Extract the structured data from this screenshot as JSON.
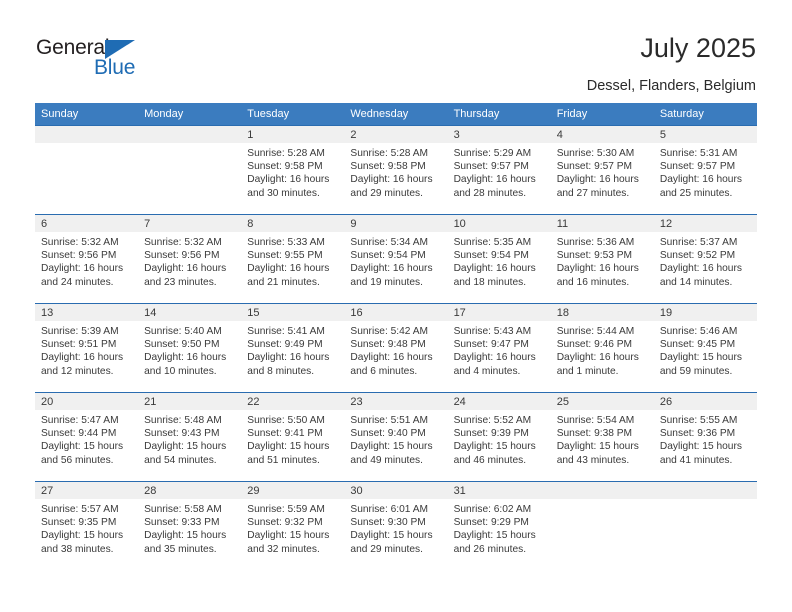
{
  "brand": {
    "name_part1": "General",
    "name_part2": "Blue"
  },
  "header": {
    "month_title": "July 2025",
    "location": "Dessel, Flanders, Belgium"
  },
  "colors": {
    "header_row_bg": "#3b7cbf",
    "week_border": "#2a6cb0",
    "daynum_band_bg": "#f0f0f0",
    "brand_blue": "#1f6cb4",
    "text": "#3a3a3a"
  },
  "weekdays": [
    "Sunday",
    "Monday",
    "Tuesday",
    "Wednesday",
    "Thursday",
    "Friday",
    "Saturday"
  ],
  "labels": {
    "sunrise_prefix": "Sunrise:",
    "sunset_prefix": "Sunset:",
    "daylight_prefix": "Daylight:"
  },
  "weeks": [
    [
      {
        "day": "",
        "empty": true
      },
      {
        "day": "",
        "empty": true
      },
      {
        "day": "1",
        "sunrise": "Sunrise: 5:28 AM",
        "sunset": "Sunset: 9:58 PM",
        "daylight_line1": "Daylight: 16 hours",
        "daylight_line2": "and 30 minutes."
      },
      {
        "day": "2",
        "sunrise": "Sunrise: 5:28 AM",
        "sunset": "Sunset: 9:58 PM",
        "daylight_line1": "Daylight: 16 hours",
        "daylight_line2": "and 29 minutes."
      },
      {
        "day": "3",
        "sunrise": "Sunrise: 5:29 AM",
        "sunset": "Sunset: 9:57 PM",
        "daylight_line1": "Daylight: 16 hours",
        "daylight_line2": "and 28 minutes."
      },
      {
        "day": "4",
        "sunrise": "Sunrise: 5:30 AM",
        "sunset": "Sunset: 9:57 PM",
        "daylight_line1": "Daylight: 16 hours",
        "daylight_line2": "and 27 minutes."
      },
      {
        "day": "5",
        "sunrise": "Sunrise: 5:31 AM",
        "sunset": "Sunset: 9:57 PM",
        "daylight_line1": "Daylight: 16 hours",
        "daylight_line2": "and 25 minutes."
      }
    ],
    [
      {
        "day": "6",
        "sunrise": "Sunrise: 5:32 AM",
        "sunset": "Sunset: 9:56 PM",
        "daylight_line1": "Daylight: 16 hours",
        "daylight_line2": "and 24 minutes."
      },
      {
        "day": "7",
        "sunrise": "Sunrise: 5:32 AM",
        "sunset": "Sunset: 9:56 PM",
        "daylight_line1": "Daylight: 16 hours",
        "daylight_line2": "and 23 minutes."
      },
      {
        "day": "8",
        "sunrise": "Sunrise: 5:33 AM",
        "sunset": "Sunset: 9:55 PM",
        "daylight_line1": "Daylight: 16 hours",
        "daylight_line2": "and 21 minutes."
      },
      {
        "day": "9",
        "sunrise": "Sunrise: 5:34 AM",
        "sunset": "Sunset: 9:54 PM",
        "daylight_line1": "Daylight: 16 hours",
        "daylight_line2": "and 19 minutes."
      },
      {
        "day": "10",
        "sunrise": "Sunrise: 5:35 AM",
        "sunset": "Sunset: 9:54 PM",
        "daylight_line1": "Daylight: 16 hours",
        "daylight_line2": "and 18 minutes."
      },
      {
        "day": "11",
        "sunrise": "Sunrise: 5:36 AM",
        "sunset": "Sunset: 9:53 PM",
        "daylight_line1": "Daylight: 16 hours",
        "daylight_line2": "and 16 minutes."
      },
      {
        "day": "12",
        "sunrise": "Sunrise: 5:37 AM",
        "sunset": "Sunset: 9:52 PM",
        "daylight_line1": "Daylight: 16 hours",
        "daylight_line2": "and 14 minutes."
      }
    ],
    [
      {
        "day": "13",
        "sunrise": "Sunrise: 5:39 AM",
        "sunset": "Sunset: 9:51 PM",
        "daylight_line1": "Daylight: 16 hours",
        "daylight_line2": "and 12 minutes."
      },
      {
        "day": "14",
        "sunrise": "Sunrise: 5:40 AM",
        "sunset": "Sunset: 9:50 PM",
        "daylight_line1": "Daylight: 16 hours",
        "daylight_line2": "and 10 minutes."
      },
      {
        "day": "15",
        "sunrise": "Sunrise: 5:41 AM",
        "sunset": "Sunset: 9:49 PM",
        "daylight_line1": "Daylight: 16 hours",
        "daylight_line2": "and 8 minutes."
      },
      {
        "day": "16",
        "sunrise": "Sunrise: 5:42 AM",
        "sunset": "Sunset: 9:48 PM",
        "daylight_line1": "Daylight: 16 hours",
        "daylight_line2": "and 6 minutes."
      },
      {
        "day": "17",
        "sunrise": "Sunrise: 5:43 AM",
        "sunset": "Sunset: 9:47 PM",
        "daylight_line1": "Daylight: 16 hours",
        "daylight_line2": "and 4 minutes."
      },
      {
        "day": "18",
        "sunrise": "Sunrise: 5:44 AM",
        "sunset": "Sunset: 9:46 PM",
        "daylight_line1": "Daylight: 16 hours",
        "daylight_line2": "and 1 minute."
      },
      {
        "day": "19",
        "sunrise": "Sunrise: 5:46 AM",
        "sunset": "Sunset: 9:45 PM",
        "daylight_line1": "Daylight: 15 hours",
        "daylight_line2": "and 59 minutes."
      }
    ],
    [
      {
        "day": "20",
        "sunrise": "Sunrise: 5:47 AM",
        "sunset": "Sunset: 9:44 PM",
        "daylight_line1": "Daylight: 15 hours",
        "daylight_line2": "and 56 minutes."
      },
      {
        "day": "21",
        "sunrise": "Sunrise: 5:48 AM",
        "sunset": "Sunset: 9:43 PM",
        "daylight_line1": "Daylight: 15 hours",
        "daylight_line2": "and 54 minutes."
      },
      {
        "day": "22",
        "sunrise": "Sunrise: 5:50 AM",
        "sunset": "Sunset: 9:41 PM",
        "daylight_line1": "Daylight: 15 hours",
        "daylight_line2": "and 51 minutes."
      },
      {
        "day": "23",
        "sunrise": "Sunrise: 5:51 AM",
        "sunset": "Sunset: 9:40 PM",
        "daylight_line1": "Daylight: 15 hours",
        "daylight_line2": "and 49 minutes."
      },
      {
        "day": "24",
        "sunrise": "Sunrise: 5:52 AM",
        "sunset": "Sunset: 9:39 PM",
        "daylight_line1": "Daylight: 15 hours",
        "daylight_line2": "and 46 minutes."
      },
      {
        "day": "25",
        "sunrise": "Sunrise: 5:54 AM",
        "sunset": "Sunset: 9:38 PM",
        "daylight_line1": "Daylight: 15 hours",
        "daylight_line2": "and 43 minutes."
      },
      {
        "day": "26",
        "sunrise": "Sunrise: 5:55 AM",
        "sunset": "Sunset: 9:36 PM",
        "daylight_line1": "Daylight: 15 hours",
        "daylight_line2": "and 41 minutes."
      }
    ],
    [
      {
        "day": "27",
        "sunrise": "Sunrise: 5:57 AM",
        "sunset": "Sunset: 9:35 PM",
        "daylight_line1": "Daylight: 15 hours",
        "daylight_line2": "and 38 minutes."
      },
      {
        "day": "28",
        "sunrise": "Sunrise: 5:58 AM",
        "sunset": "Sunset: 9:33 PM",
        "daylight_line1": "Daylight: 15 hours",
        "daylight_line2": "and 35 minutes."
      },
      {
        "day": "29",
        "sunrise": "Sunrise: 5:59 AM",
        "sunset": "Sunset: 9:32 PM",
        "daylight_line1": "Daylight: 15 hours",
        "daylight_line2": "and 32 minutes."
      },
      {
        "day": "30",
        "sunrise": "Sunrise: 6:01 AM",
        "sunset": "Sunset: 9:30 PM",
        "daylight_line1": "Daylight: 15 hours",
        "daylight_line2": "and 29 minutes."
      },
      {
        "day": "31",
        "sunrise": "Sunrise: 6:02 AM",
        "sunset": "Sunset: 9:29 PM",
        "daylight_line1": "Daylight: 15 hours",
        "daylight_line2": "and 26 minutes."
      },
      {
        "day": "",
        "empty": true
      },
      {
        "day": "",
        "empty": true
      }
    ]
  ]
}
